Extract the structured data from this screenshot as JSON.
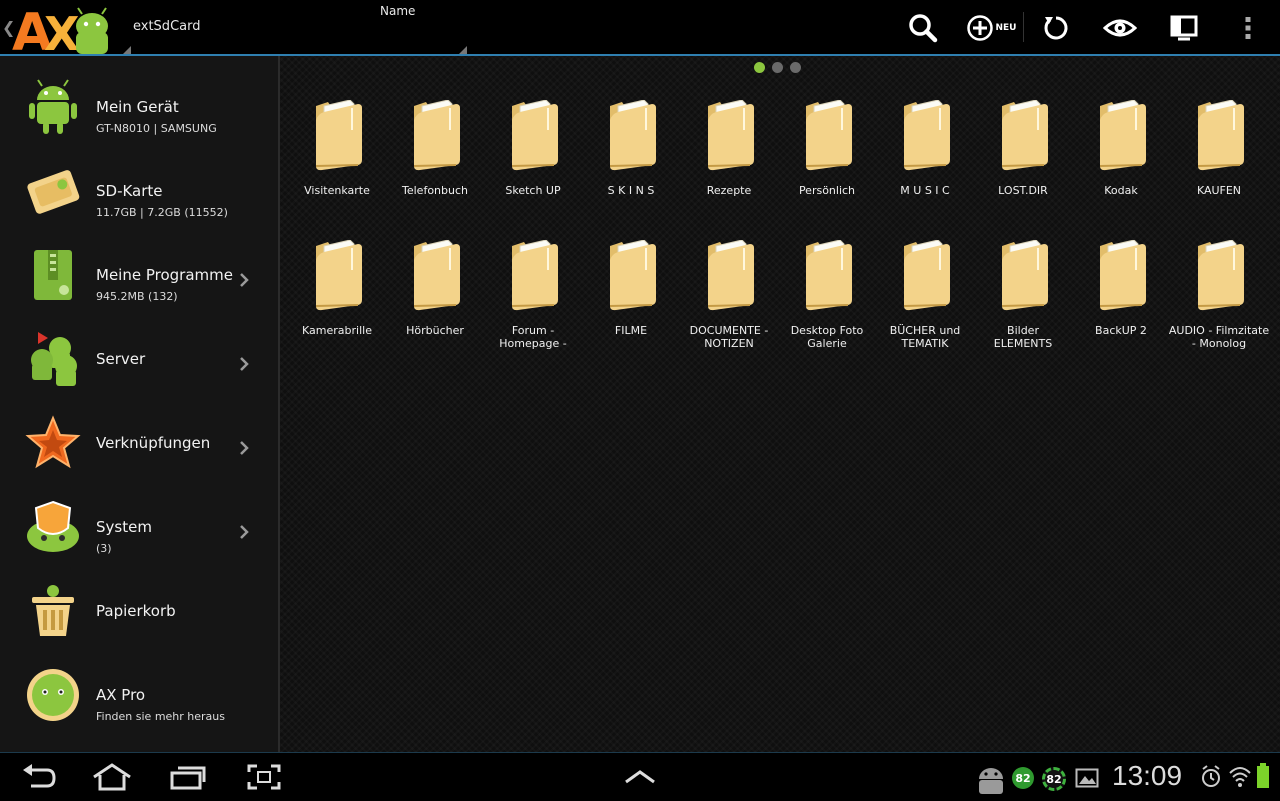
{
  "header": {
    "location": "extSdCard",
    "sort_label": "Name",
    "new_label": "NEU"
  },
  "sidebar": {
    "items": [
      {
        "title": "Mein Gerät",
        "sub": "GT-N8010 | SAMSUNG"
      },
      {
        "title": "SD-Karte",
        "sub": "11.7GB | 7.2GB (11552)"
      },
      {
        "title": "Meine Programme",
        "sub": "945.2MB (132)"
      },
      {
        "title": "Server",
        "sub": ""
      },
      {
        "title": "Verknüpfungen",
        "sub": ""
      },
      {
        "title": "System",
        "sub": "(3)"
      },
      {
        "title": "Papierkorb",
        "sub": ""
      },
      {
        "title": "AX Pro",
        "sub": "Finden sie mehr heraus"
      }
    ]
  },
  "folders": [
    {
      "l1": "Visitenkarte",
      "l2": ""
    },
    {
      "l1": "Telefonbuch",
      "l2": ""
    },
    {
      "l1": "Sketch UP",
      "l2": ""
    },
    {
      "l1": "S K I N S",
      "l2": ""
    },
    {
      "l1": "Rezepte",
      "l2": ""
    },
    {
      "l1": "Persönlich",
      "l2": ""
    },
    {
      "l1": "M U S I C",
      "l2": ""
    },
    {
      "l1": "LOST.DIR",
      "l2": ""
    },
    {
      "l1": "Kodak",
      "l2": ""
    },
    {
      "l1": "KAUFEN",
      "l2": ""
    },
    {
      "l1": "Kamerabrille",
      "l2": ""
    },
    {
      "l1": "Hörbücher",
      "l2": ""
    },
    {
      "l1": "Forum -",
      "l2": "Homepage -"
    },
    {
      "l1": "FILME",
      "l2": ""
    },
    {
      "l1": "DOCUMENTE -",
      "l2": "NOTIZEN"
    },
    {
      "l1": "Desktop Foto",
      "l2": "Galerie"
    },
    {
      "l1": "BÜCHER  und",
      "l2": "TEMATIK"
    },
    {
      "l1": "Bilder",
      "l2": "ELEMENTS"
    },
    {
      "l1": "BackUP 2",
      "l2": ""
    },
    {
      "l1": "AUDIO - Filmzitate",
      "l2": "- Monolog"
    }
  ],
  "statusbar": {
    "battery_badge_1": "82",
    "battery_badge_2": "82",
    "time": "13:09"
  },
  "colors": {
    "accent": "#2f7fb0",
    "active_dot": "#8cc63f",
    "folder": "#f3d38a"
  }
}
